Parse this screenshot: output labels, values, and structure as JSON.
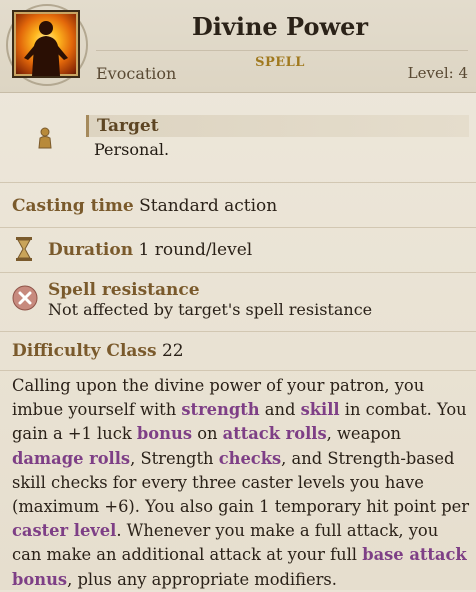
{
  "header": {
    "title": "Divine Power",
    "tag": "SPELL",
    "school": "Evocation",
    "level": "Level: 4"
  },
  "target": {
    "label": "Target",
    "value": "Personal."
  },
  "casting_time": {
    "label": "Casting time",
    "value": "Standard action"
  },
  "duration": {
    "label": "Duration",
    "value": "1 round/level"
  },
  "spell_resistance": {
    "label": "Spell resistance",
    "value": "Not affected by target's spell resistance"
  },
  "difficulty_class": {
    "label": "Difficulty Class",
    "value": "22"
  },
  "description": {
    "p1": "Calling upon the divine power of your patron, you imbue yourself with ",
    "k1": "strength",
    "p2": " and ",
    "k2": "skill",
    "p3": " in combat. You gain a +1 luck ",
    "k3": "bonus",
    "p4": " on ",
    "k4": "attack rolls",
    "p5": ", weapon ",
    "k5": "damage rolls",
    "p6": ", Strength ",
    "k6": "checks",
    "p7": ", and Strength-based skill checks for every three caster levels you have (maximum +6). You also gain 1 temporary hit point per ",
    "k7": "caster level",
    "p8": ". Whenever you make a full attack, you can make an additional attack at your full ",
    "k8": "base attack bonus",
    "p9": ", plus any appropriate modifiers."
  },
  "colors": {
    "label": "#7a5a2c",
    "keyword": "#7e3f86",
    "spell_tag": "#a0791e"
  },
  "icons": [
    "divine-power-portrait-icon",
    "target-person-icon",
    "hourglass-icon",
    "spell-resistance-x-icon"
  ]
}
